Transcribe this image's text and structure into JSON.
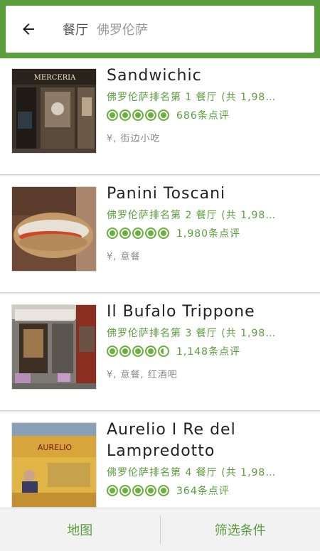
{
  "search": {
    "category": "餐厅",
    "location": "佛罗伦萨"
  },
  "colors": {
    "brand": "#5a9e3e",
    "bubble": "#6bb13f"
  },
  "restaurants": [
    {
      "name": "Sandwichic",
      "rank": "佛罗伦萨排名第 1 餐厅 (共 1,98…",
      "reviews": "686条点评",
      "rating": 5,
      "cuisine": "¥, 街边小吃"
    },
    {
      "name": "Panini Toscani",
      "rank": "佛罗伦萨排名第 2 餐厅 (共 1,98…",
      "reviews": "1,980条点评",
      "rating": 5,
      "cuisine": "¥, 意餐"
    },
    {
      "name": "Il Bufalo Trippone",
      "rank": "佛罗伦萨排名第 3 餐厅 (共 1,98…",
      "reviews": "1,148条点评",
      "rating": 4.5,
      "cuisine": "¥, 意餐, 红酒吧"
    },
    {
      "name": "Aurelio I Re del Lampredotto",
      "rank": "佛罗伦萨排名第 4 餐厅 (共 1,98…",
      "reviews": "364条点评",
      "rating": 5,
      "cuisine": ""
    }
  ],
  "photo_texts": {
    "mercerie": "MERCERIA",
    "aurelio": "AURELIO"
  },
  "bottom": {
    "map": "地图",
    "filter": "筛选条件"
  }
}
